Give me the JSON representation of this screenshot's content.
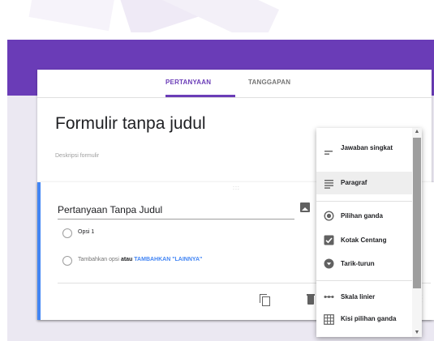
{
  "tabs": {
    "questions": "PERTANYAAN",
    "responses": "TANGGAPAN"
  },
  "form": {
    "title": "Formulir tanpa judul",
    "description": "Deskripsi formulir"
  },
  "question": {
    "title": "Pertanyaan Tanpa Judul",
    "option1": "Opsi 1",
    "add_option": "Tambahkan opsi",
    "or": "atau",
    "add_other": "TAMBAHKAN \"LAINNYA\""
  },
  "menu": {
    "items": [
      {
        "label": "Jawaban singkat",
        "icon": "short-answer-icon"
      },
      {
        "label": "Paragraf",
        "icon": "paragraph-icon",
        "selected": true
      },
      {
        "label": "Pilihan ganda",
        "icon": "radio-icon"
      },
      {
        "label": "Kotak Centang",
        "icon": "checkbox-icon"
      },
      {
        "label": "Tarik-turun",
        "icon": "dropdown-icon"
      },
      {
        "label": "Skala linier",
        "icon": "linear-scale-icon"
      },
      {
        "label": "Kisi pilihan ganda",
        "icon": "grid-icon"
      }
    ]
  },
  "colors": {
    "accent": "#6a3cb7",
    "link": "#4285f4",
    "background": "#ebe8f2"
  }
}
